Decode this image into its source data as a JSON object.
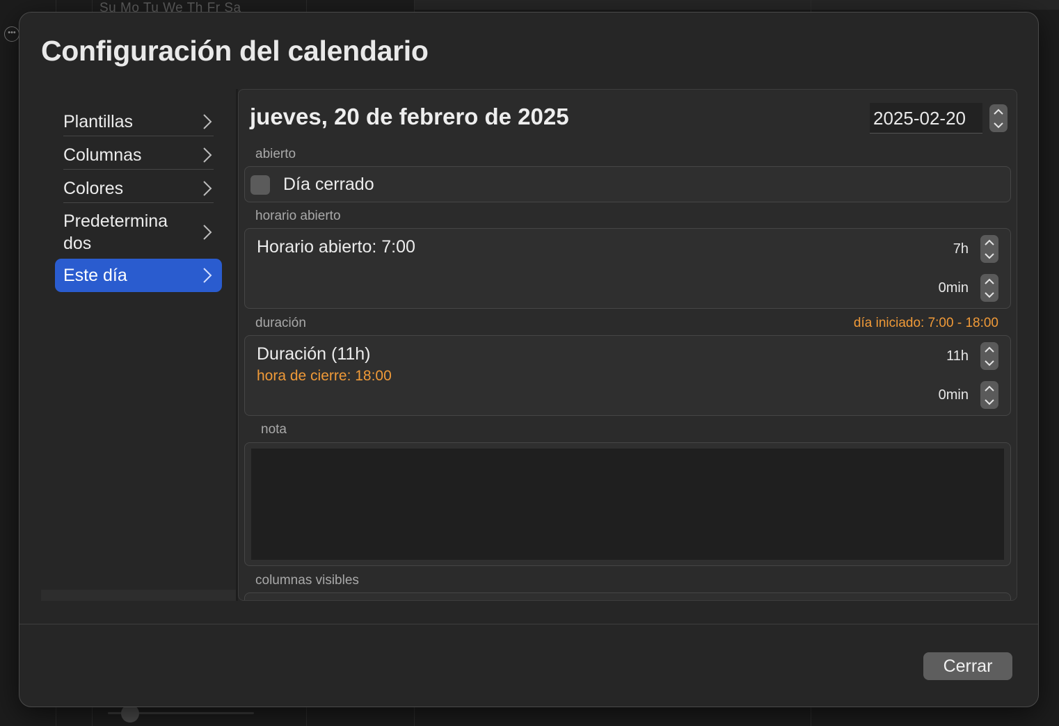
{
  "background": {
    "weekday_header": "Su Mo Tu We Th Fr Sa",
    "more_icon": "ellipsis-circle-icon"
  },
  "sheet": {
    "title": "Configuración del calendario"
  },
  "sidebar": {
    "items": [
      {
        "label": "Plantillas",
        "selected": false
      },
      {
        "label": "Columnas",
        "selected": false
      },
      {
        "label": "Colores",
        "selected": false
      },
      {
        "label": "Predetermina dos",
        "line1": "Predetermina",
        "line2": "dos",
        "selected": false
      },
      {
        "label": "Este día",
        "selected": true
      }
    ],
    "selected_color": "#2a5ccf"
  },
  "detail": {
    "date_heading": "jueves, 20 de febrero de 2025",
    "date_value": "2025-02-20",
    "sections": {
      "open_label": "abierto",
      "closed_checkbox_label": "Día cerrado",
      "closed_checked": false,
      "open_hours_label": "horario abierto",
      "open_hours_title": "Horario abierto: 7:00",
      "open_hours_h": "7h",
      "open_hours_min": "0min",
      "duration_label": "duración",
      "duration_info": "día iniciado: 7:00 - 18:00",
      "duration_title": "Duración (11h)",
      "closing_time": "hora de cierre: 18:00",
      "duration_h": "11h",
      "duration_min": "0min",
      "note_label": "nota",
      "note_value": "",
      "visible_columns_label": "columnas visibles"
    },
    "accent_orange": "#f09a38"
  },
  "footer": {
    "close_label": "Cerrar"
  }
}
